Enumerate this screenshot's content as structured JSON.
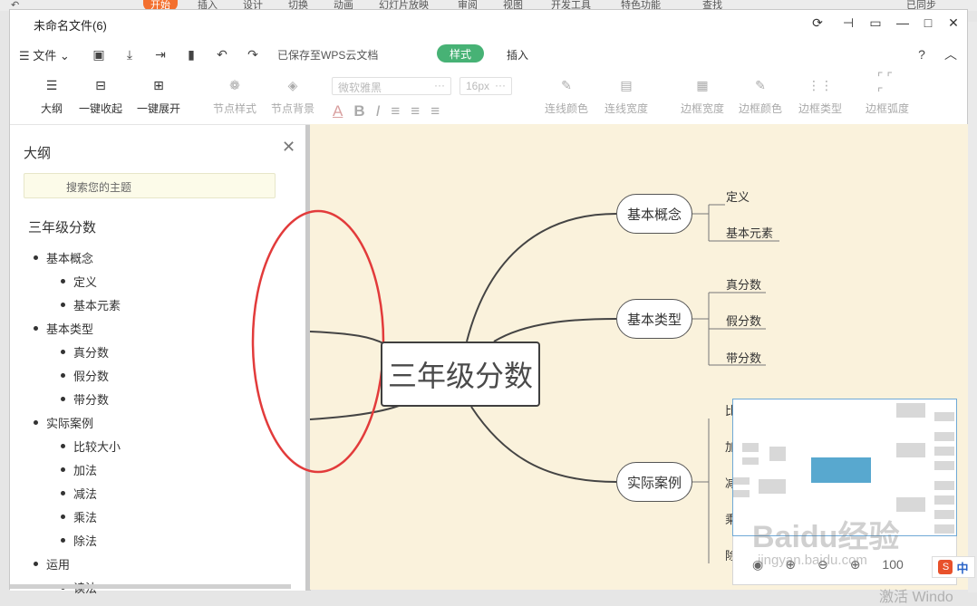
{
  "host": {
    "tabs": [
      "开始",
      "插入",
      "设计",
      "切换",
      "动画",
      "幻灯片放映",
      "审阅",
      "视图",
      "开发工具",
      "特色功能",
      "查找",
      "已同步"
    ]
  },
  "window": {
    "title": "未命名文件(6)"
  },
  "menubar": {
    "file_label": "文件",
    "save_status": "已保存至WPS云文档",
    "tab_style": "样式",
    "tab_insert": "插入"
  },
  "ribbon": {
    "outline": "大纲",
    "collapse_all": "一键收起",
    "expand_all": "一键展开",
    "node_style": "节点样式",
    "node_bg": "节点背景",
    "font_name": "微软雅黑",
    "font_size": "16px",
    "line_color": "连线颜色",
    "line_width": "连线宽度",
    "border_width": "边框宽度",
    "border_color": "边框颜色",
    "border_type": "边框类型",
    "border_radius": "边框弧度"
  },
  "outline_panel": {
    "title": "大纲",
    "search_placeholder": "搜索您的主题",
    "root": "三年级分数",
    "items": [
      {
        "label": "基本概念",
        "level": 1
      },
      {
        "label": "定义",
        "level": 2
      },
      {
        "label": "基本元素",
        "level": 2
      },
      {
        "label": "基本类型",
        "level": 1
      },
      {
        "label": "真分数",
        "level": 2
      },
      {
        "label": "假分数",
        "level": 2
      },
      {
        "label": "带分数",
        "level": 2
      },
      {
        "label": "实际案例",
        "level": 1
      },
      {
        "label": "比较大小",
        "level": 2
      },
      {
        "label": "加法",
        "level": 2
      },
      {
        "label": "减法",
        "level": 2
      },
      {
        "label": "乘法",
        "level": 2
      },
      {
        "label": "除法",
        "level": 2
      },
      {
        "label": "运用",
        "level": 1
      },
      {
        "label": "读法",
        "level": 2
      }
    ]
  },
  "mindmap": {
    "root": "三年级分数",
    "branches": [
      {
        "label": "基本概念",
        "leaves": [
          "定义",
          "基本元素"
        ]
      },
      {
        "label": "基本类型",
        "leaves": [
          "真分数",
          "假分数",
          "带分数"
        ]
      },
      {
        "label": "实际案例",
        "leaves": [
          "比",
          "加",
          "减",
          "乘",
          "除"
        ]
      }
    ]
  },
  "minimap": {
    "zoom_label": "100"
  },
  "ime": {
    "label": "中"
  },
  "overlay": {
    "watermark": "Baidu经验",
    "watermark_url": "jingyan.baidu.com",
    "activate": "激活 Windo"
  }
}
